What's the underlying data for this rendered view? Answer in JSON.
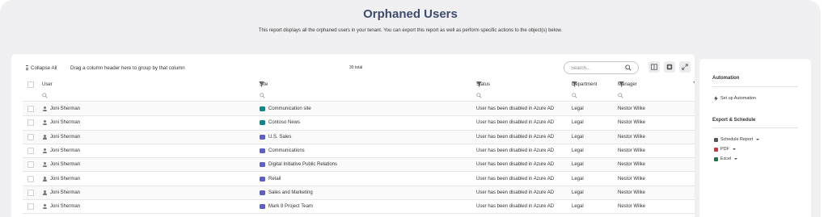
{
  "header": {
    "title": "Orphaned Users",
    "description": "This report displays all the orphaned users in your tenant. You can export this report as well as perform specific actions to the object(s) below."
  },
  "toolbar": {
    "collapse_label": "Collapse All",
    "group_hint": "Drag a column header here to group by that column",
    "total": "30 total",
    "search_placeholder": "Search..."
  },
  "columns": [
    "User",
    "Site",
    "Status",
    "Department",
    "Manager"
  ],
  "rows": [
    {
      "user": "Joni Sherman",
      "site": "Communication site",
      "site_type": "comm",
      "status": "User has been disabled in Azure AD",
      "department": "Legal",
      "manager": "Nestor Wilke"
    },
    {
      "user": "Joni Sherman",
      "site": "Contoso News",
      "site_type": "comm",
      "status": "User has been disabled in Azure AD",
      "department": "Legal",
      "manager": "Nestor Wilke"
    },
    {
      "user": "Joni Sherman",
      "site": "U.S. Sales",
      "site_type": "team",
      "status": "User has been disabled in Azure AD",
      "department": "Legal",
      "manager": "Nestor Wilke"
    },
    {
      "user": "Joni Sherman",
      "site": "Communications",
      "site_type": "team",
      "status": "User has been disabled in Azure AD",
      "department": "Legal",
      "manager": "Nestor Wilke"
    },
    {
      "user": "Joni Sherman",
      "site": "Digital Initiative Public Relations",
      "site_type": "team",
      "status": "User has been disabled in Azure AD",
      "department": "Legal",
      "manager": "Nestor Wilke"
    },
    {
      "user": "Joni Sherman",
      "site": "Retail",
      "site_type": "team",
      "status": "User has been disabled in Azure AD",
      "department": "Legal",
      "manager": "Nestor Wilke"
    },
    {
      "user": "Joni Sherman",
      "site": "Sales and Marketing",
      "site_type": "team",
      "status": "User has been disabled in Azure AD",
      "department": "Legal",
      "manager": "Nestor Wilke"
    },
    {
      "user": "Joni Sherman",
      "site": "Mark 8 Project Team",
      "site_type": "team",
      "status": "User has been disabled in Azure AD",
      "department": "Legal",
      "manager": "Nestor Wilke"
    }
  ],
  "sidebar": {
    "automation_title": "Automation",
    "setup_automation": "Set up Automation",
    "export_title": "Export & Schedule",
    "schedule_report": "Schedule Report",
    "pdf": "PDF",
    "excel": "Excel"
  },
  "colors": {
    "title": "#3e4b6c",
    "communication_site_icon": "#0a8a8a",
    "team_site_icon": "#5b5fc7",
    "pdf_icon": "#d13438",
    "excel_icon": "#217346"
  }
}
